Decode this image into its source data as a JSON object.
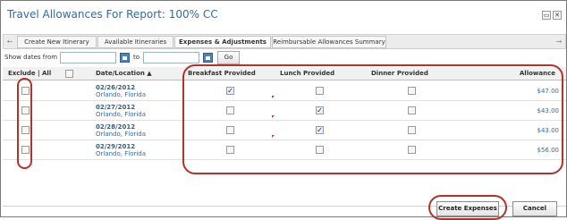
{
  "dialog": {
    "title": "Travel Allowances For Report: 100% CC",
    "window_buttons": [
      "▭",
      "✕"
    ]
  },
  "tabs": {
    "left_arrow": "←",
    "right_arrow": "→",
    "items": [
      {
        "label": "Create New Itinerary"
      },
      {
        "label": "Available Itineraries"
      },
      {
        "label": "Expenses & Adjustments"
      },
      {
        "label": "Reimbursable Allowances Summary"
      }
    ]
  },
  "filter": {
    "show_dates_from_label": "Show dates from",
    "from_value": "",
    "to_label": "to",
    "to_value": "",
    "go_label": "Go"
  },
  "table": {
    "headers": {
      "exclude": "Exclude | All",
      "date_location": "Date/Location ▲",
      "breakfast": "Breakfast Provided",
      "lunch": "Lunch Provided",
      "dinner": "Dinner Provided",
      "allowance": "Allowance"
    },
    "rows": [
      {
        "date": "02/26/2012",
        "location": "Orlando, Florida",
        "exclude": false,
        "breakfast": true,
        "lunch": false,
        "dinner": false,
        "allowance": "$47.00"
      },
      {
        "date": "02/27/2012",
        "location": "Orlando, Florida",
        "exclude": false,
        "breakfast": false,
        "lunch": true,
        "dinner": false,
        "allowance": "$43.00"
      },
      {
        "date": "02/28/2012",
        "location": "Orlando, Florida",
        "exclude": false,
        "breakfast": false,
        "lunch": true,
        "dinner": false,
        "allowance": "$43.00"
      },
      {
        "date": "02/29/2012",
        "location": "Orlando, Florida",
        "exclude": false,
        "breakfast": false,
        "lunch": false,
        "dinner": false,
        "allowance": "$56.00"
      }
    ]
  },
  "footer": {
    "create_expenses_label": "Create Expenses",
    "cancel_label": "Cancel"
  },
  "colors": {
    "title": "#2d6da3",
    "annotation": "#b5312a"
  }
}
